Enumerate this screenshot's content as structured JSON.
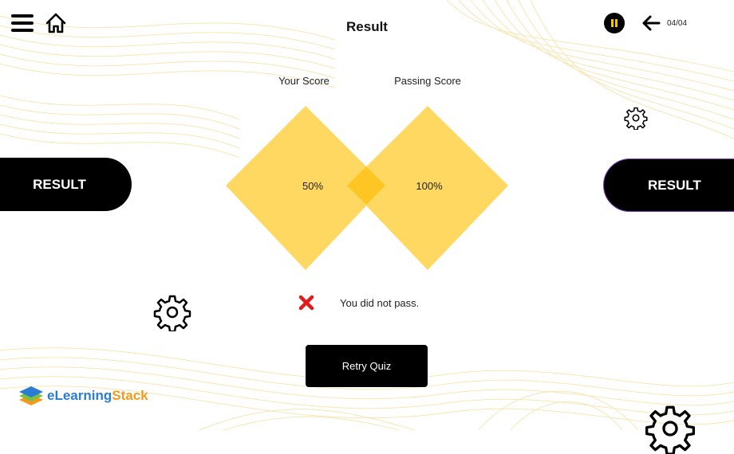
{
  "header": {
    "title": "Result",
    "page_counter": "04/04",
    "icons": {
      "menu": "hamburger-menu-icon",
      "home": "home-icon",
      "pause": "pause-icon",
      "back": "arrow-left-icon"
    }
  },
  "scores": {
    "your_label": "Your Score",
    "your_value": "50%",
    "passing_label": "Passing Score",
    "passing_value": "100%"
  },
  "side_labels": {
    "left": "RESULT",
    "right": "RESULT"
  },
  "status": {
    "icon": "red-x-icon",
    "text": "You did not pass."
  },
  "retry_button": "Retry Quiz",
  "logo": {
    "part1": "eLearning",
    "part2": "Stack"
  },
  "colors": {
    "accent_yellow": "#ffd34e",
    "overlap_yellow": "#ffc21e",
    "pill_black": "#000000",
    "fail_red": "#e01b1b",
    "logo_blue": "#2b7cd3",
    "logo_orange": "#f39a1e"
  }
}
